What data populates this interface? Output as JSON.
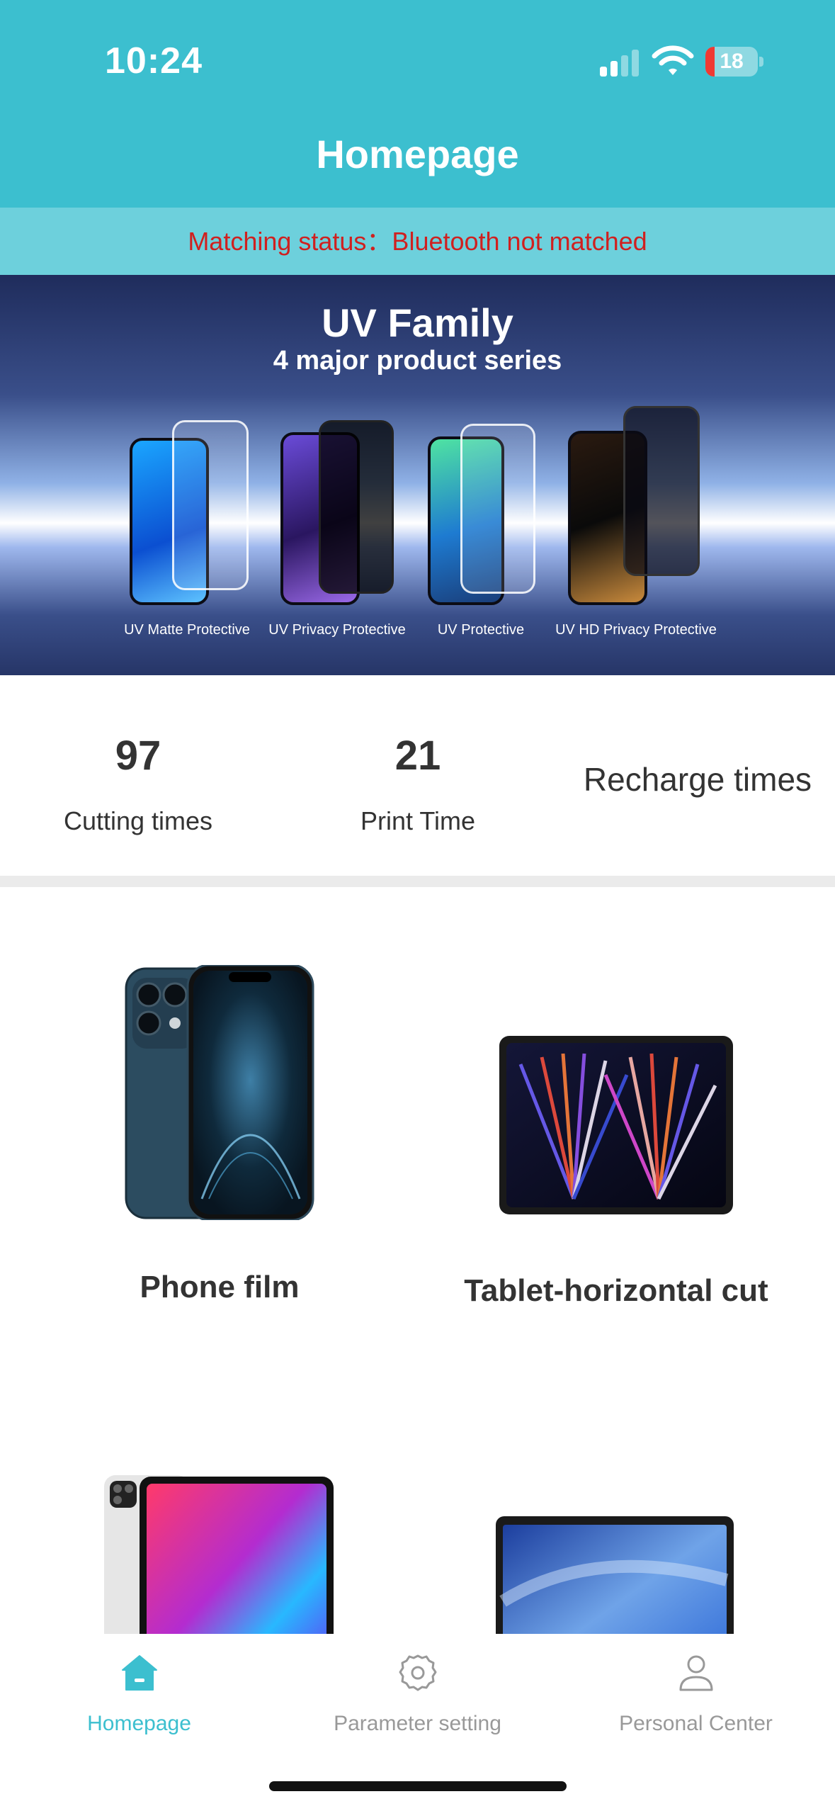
{
  "status_bar": {
    "time": "10:24",
    "battery": "18",
    "battery_level": 0.18
  },
  "header": {
    "title": "Homepage"
  },
  "match_status": {
    "text": "Matching status：Bluetooth not matched",
    "color": "#d0201f"
  },
  "banner": {
    "title": "UV Family",
    "subtitle": "4 major product series",
    "products": [
      {
        "label": "UV Matte Protective"
      },
      {
        "label": "UV Privacy Protective"
      },
      {
        "label": "UV Protective"
      },
      {
        "label": "UV HD Privacy Protective"
      }
    ]
  },
  "stats": {
    "cutting": {
      "value": "97",
      "label": "Cutting times"
    },
    "print": {
      "value": "21",
      "label": "Print Time"
    },
    "recharge": {
      "label": "Recharge times"
    }
  },
  "grid": {
    "items": [
      {
        "label": "Phone film",
        "icon": "phone-image"
      },
      {
        "label": "Tablet-horizontal cut",
        "icon": "tablet-image"
      },
      {
        "label": "",
        "icon": "ipad-image"
      },
      {
        "label": "",
        "icon": "laptop-image"
      }
    ]
  },
  "tabbar": {
    "tabs": [
      {
        "label": "Homepage",
        "icon": "home-icon",
        "active": true
      },
      {
        "label": "Parameter setting",
        "icon": "gear-icon",
        "active": false
      },
      {
        "label": "Personal Center",
        "icon": "user-icon",
        "active": false
      }
    ]
  },
  "colors": {
    "accent": "#3cbfcf",
    "match_bar": "#6dd0dc",
    "error_text": "#d0201f",
    "inactive_tab": "#999999"
  }
}
